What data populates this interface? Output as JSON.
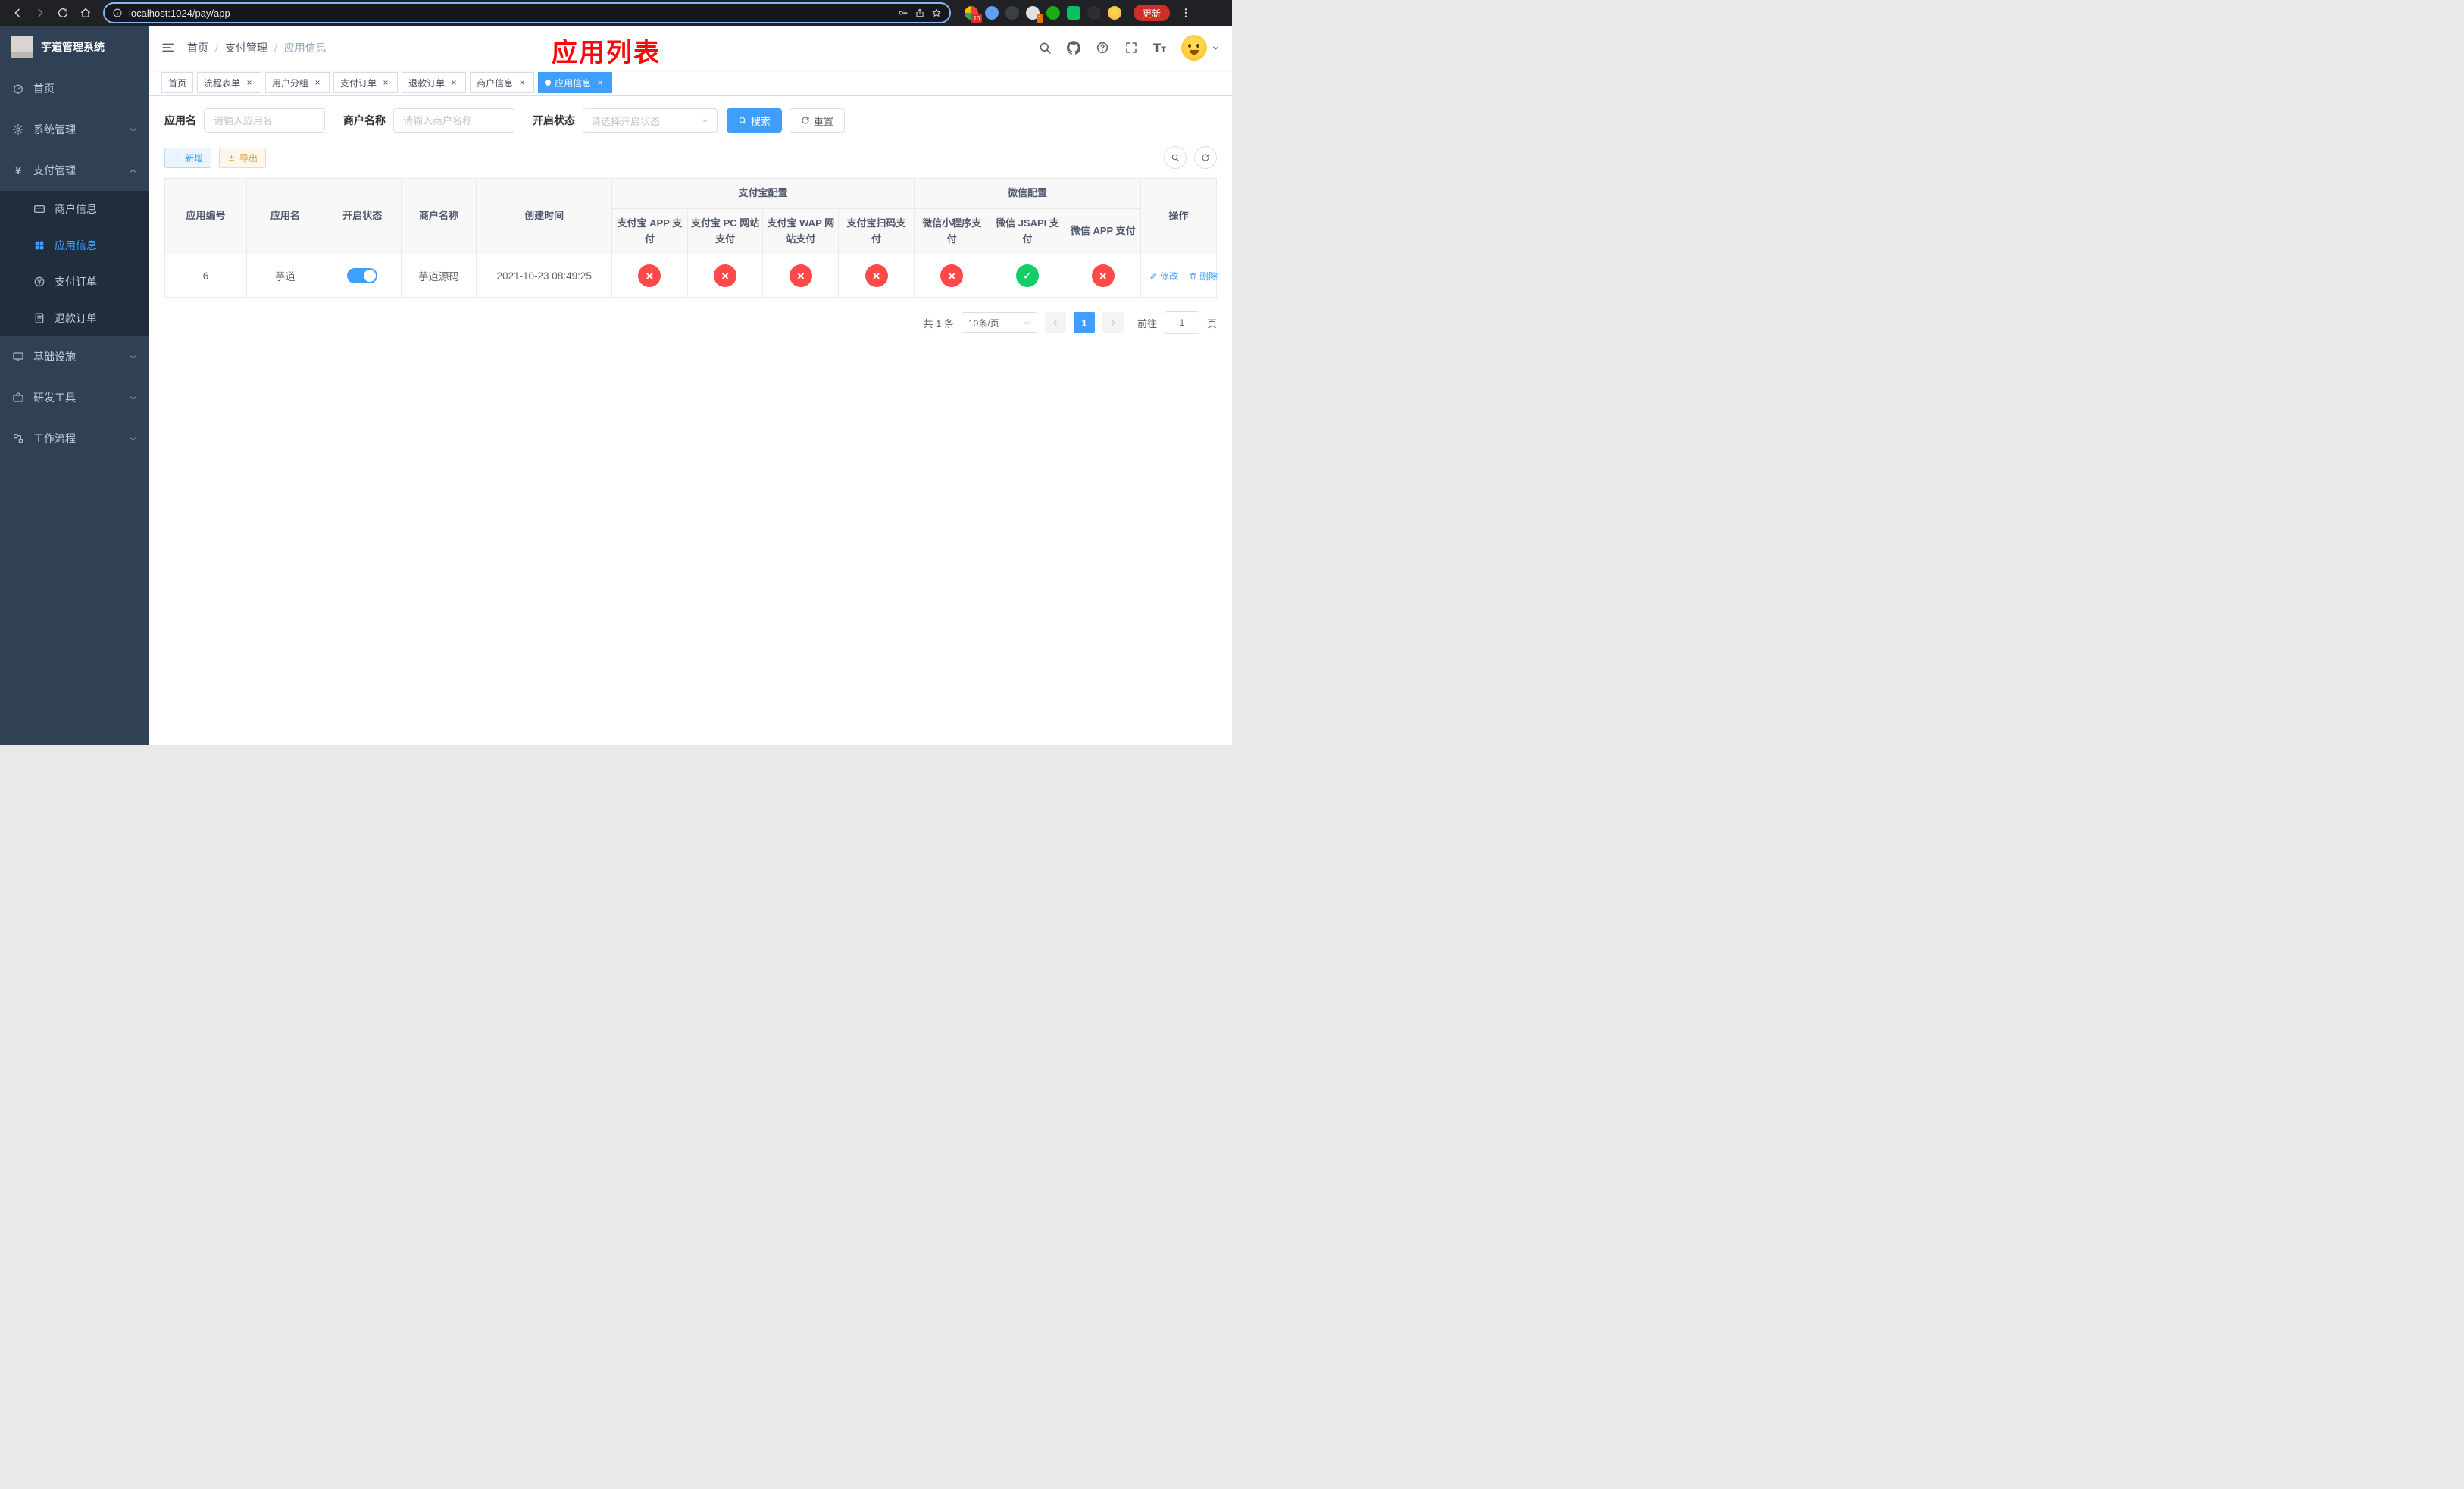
{
  "browser": {
    "url": "localhost:1024/pay/app",
    "update_label": "更新",
    "ext_badge_1": "10",
    "ext_badge_2": "1"
  },
  "sidebar": {
    "title": "芋道管理系统",
    "items": [
      {
        "label": "首页"
      },
      {
        "label": "系统管理"
      },
      {
        "label": "支付管理"
      },
      {
        "label": "基础设施"
      },
      {
        "label": "研发工具"
      },
      {
        "label": "工作流程"
      }
    ],
    "pay_children": [
      {
        "label": "商户信息"
      },
      {
        "label": "应用信息"
      },
      {
        "label": "支付订单"
      },
      {
        "label": "退款订单"
      }
    ]
  },
  "header": {
    "breadcrumb": [
      "首页",
      "支付管理",
      "应用信息"
    ],
    "annotation": "应用列表"
  },
  "tabs": [
    {
      "label": "首页"
    },
    {
      "label": "流程表单"
    },
    {
      "label": "用户分组"
    },
    {
      "label": "支付订单"
    },
    {
      "label": "退款订单"
    },
    {
      "label": "商户信息"
    },
    {
      "label": "应用信息"
    }
  ],
  "filters": {
    "app_name_label": "应用名",
    "app_name_placeholder": "请输入应用名",
    "merchant_label": "商户名称",
    "merchant_placeholder": "请输入商户名称",
    "status_label": "开启状态",
    "status_placeholder": "请选择开启状态",
    "search_button": "搜索",
    "reset_button": "重置"
  },
  "toolbar": {
    "add_label": "新增",
    "export_label": "导出"
  },
  "table": {
    "group_alipay": "支付宝配置",
    "group_wechat": "微信配置",
    "columns": [
      "应用编号",
      "应用名",
      "开启状态",
      "商户名称",
      "创建时间",
      "支付宝 APP 支付",
      "支付宝 PC 网站支付",
      "支付宝 WAP 网站支付",
      "支付宝扫码支付",
      "微信小程序支付",
      "微信 JSAPI 支付",
      "微信 APP 支付",
      "操作"
    ],
    "rows": [
      {
        "id": "6",
        "name": "芋道",
        "enabled": true,
        "merchant": "芋道源码",
        "created_at": "2021-10-23 08:49:25",
        "alipay_app": false,
        "alipay_pc": false,
        "alipay_wap": false,
        "alipay_qr": false,
        "wechat_mini": false,
        "wechat_jsapi": true,
        "wechat_app": false,
        "edit_label": "修改",
        "delete_label": "删除"
      }
    ]
  },
  "pagination": {
    "total": "共 1 条",
    "page_size": "10条/页",
    "page": "1",
    "goto_label": "前往",
    "goto_value": "1",
    "unit_label": "页"
  },
  "colors": {
    "accent": "#409eff",
    "success": "#13ce66",
    "danger": "#ff4949",
    "sidebar_bg": "#304156",
    "submenu_bg": "#1f2d3d",
    "annotation": "#fa0a0a"
  },
  "icons": {
    "back-icon": "arrow-left",
    "forward-icon": "arrow-right",
    "reload-icon": "circular-arrow",
    "home-icon": "house",
    "info-icon": "circle-i",
    "key-icon": "key",
    "share-icon": "box-arrow-up",
    "star-icon": "star-outline",
    "menu-dots-icon": "vertical-dots",
    "hamburger-icon": "three-lines",
    "search-icon": "magnifier",
    "github-icon": "octocat",
    "help-icon": "circle-question",
    "fullscreen-icon": "expand-corners",
    "font-size-icon": "double-T",
    "dashboard-icon": "gauge",
    "system-icon": "gear",
    "payment-icon": "yen-sign",
    "merchant-icon": "credit-card",
    "app-info-icon": "grid-squares",
    "pay-order-icon": "coin-yen",
    "refund-order-icon": "document",
    "infrastructure-icon": "monitor",
    "devtools-icon": "briefcase",
    "workflow-icon": "flow-nodes",
    "add-icon": "plus",
    "export-icon": "download-arrow",
    "edit-icon": "pencil",
    "delete-icon": "trash",
    "enabled-status-icon": "check-circle",
    "disabled-status-icon": "x-circle"
  }
}
